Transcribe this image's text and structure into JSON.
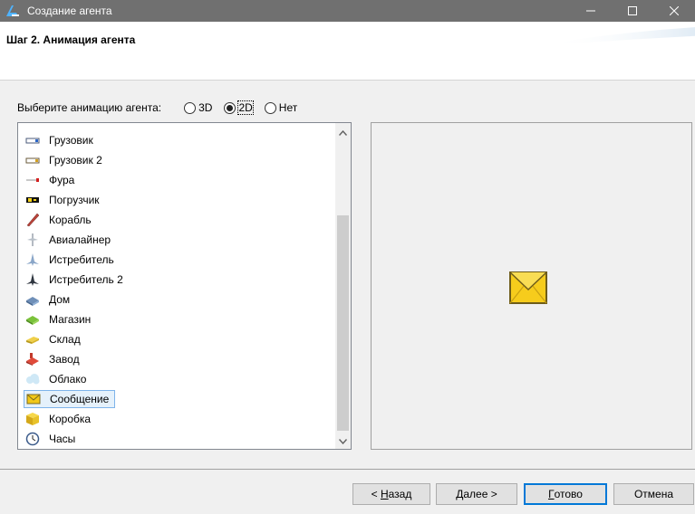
{
  "window": {
    "title": "Создание агента",
    "minimize_icon": "minimize-icon",
    "maximize_icon": "maximize-icon",
    "close_icon": "close-icon"
  },
  "header": {
    "step_title": "Шаг 2. Анимация агента"
  },
  "animation": {
    "label": "Выберите анимацию агента:",
    "options": [
      {
        "label": "3D",
        "selected": false
      },
      {
        "label": "2D",
        "selected": true
      },
      {
        "label": "Нет",
        "selected": false
      }
    ]
  },
  "items": [
    {
      "label": "Грузовик",
      "icon": "truck-icon"
    },
    {
      "label": "Грузовик 2",
      "icon": "truck-2-icon"
    },
    {
      "label": "Фура",
      "icon": "semi-truck-icon"
    },
    {
      "label": "Погрузчик",
      "icon": "forklift-icon"
    },
    {
      "label": "Корабль",
      "icon": "ship-icon"
    },
    {
      "label": "Авиалайнер",
      "icon": "airliner-icon"
    },
    {
      "label": "Истребитель",
      "icon": "fighter-jet-icon"
    },
    {
      "label": "Истребитель 2",
      "icon": "fighter-jet-2-icon"
    },
    {
      "label": "Дом",
      "icon": "house-icon"
    },
    {
      "label": "Магазин",
      "icon": "shop-icon"
    },
    {
      "label": "Склад",
      "icon": "warehouse-icon"
    },
    {
      "label": "Завод",
      "icon": "factory-icon"
    },
    {
      "label": "Облако",
      "icon": "cloud-icon"
    },
    {
      "label": "Сообщение",
      "icon": "envelope-icon",
      "selected": true
    },
    {
      "label": "Коробка",
      "icon": "box-icon"
    },
    {
      "label": "Часы",
      "icon": "clock-icon"
    }
  ],
  "preview": {
    "icon": "envelope-preview-icon"
  },
  "buttons": {
    "back_prefix": "< ",
    "back_key": "Н",
    "back_rest": "азад",
    "next_key": "Д",
    "next_rest": "алее >",
    "done_key": "Г",
    "done_rest": "отово",
    "cancel": "Отмена"
  },
  "colors": {
    "titlebar": "#707070",
    "selection_bg": "#e5f1fb",
    "selection_border": "#7eb4ea",
    "default_button_border": "#0078d7"
  }
}
